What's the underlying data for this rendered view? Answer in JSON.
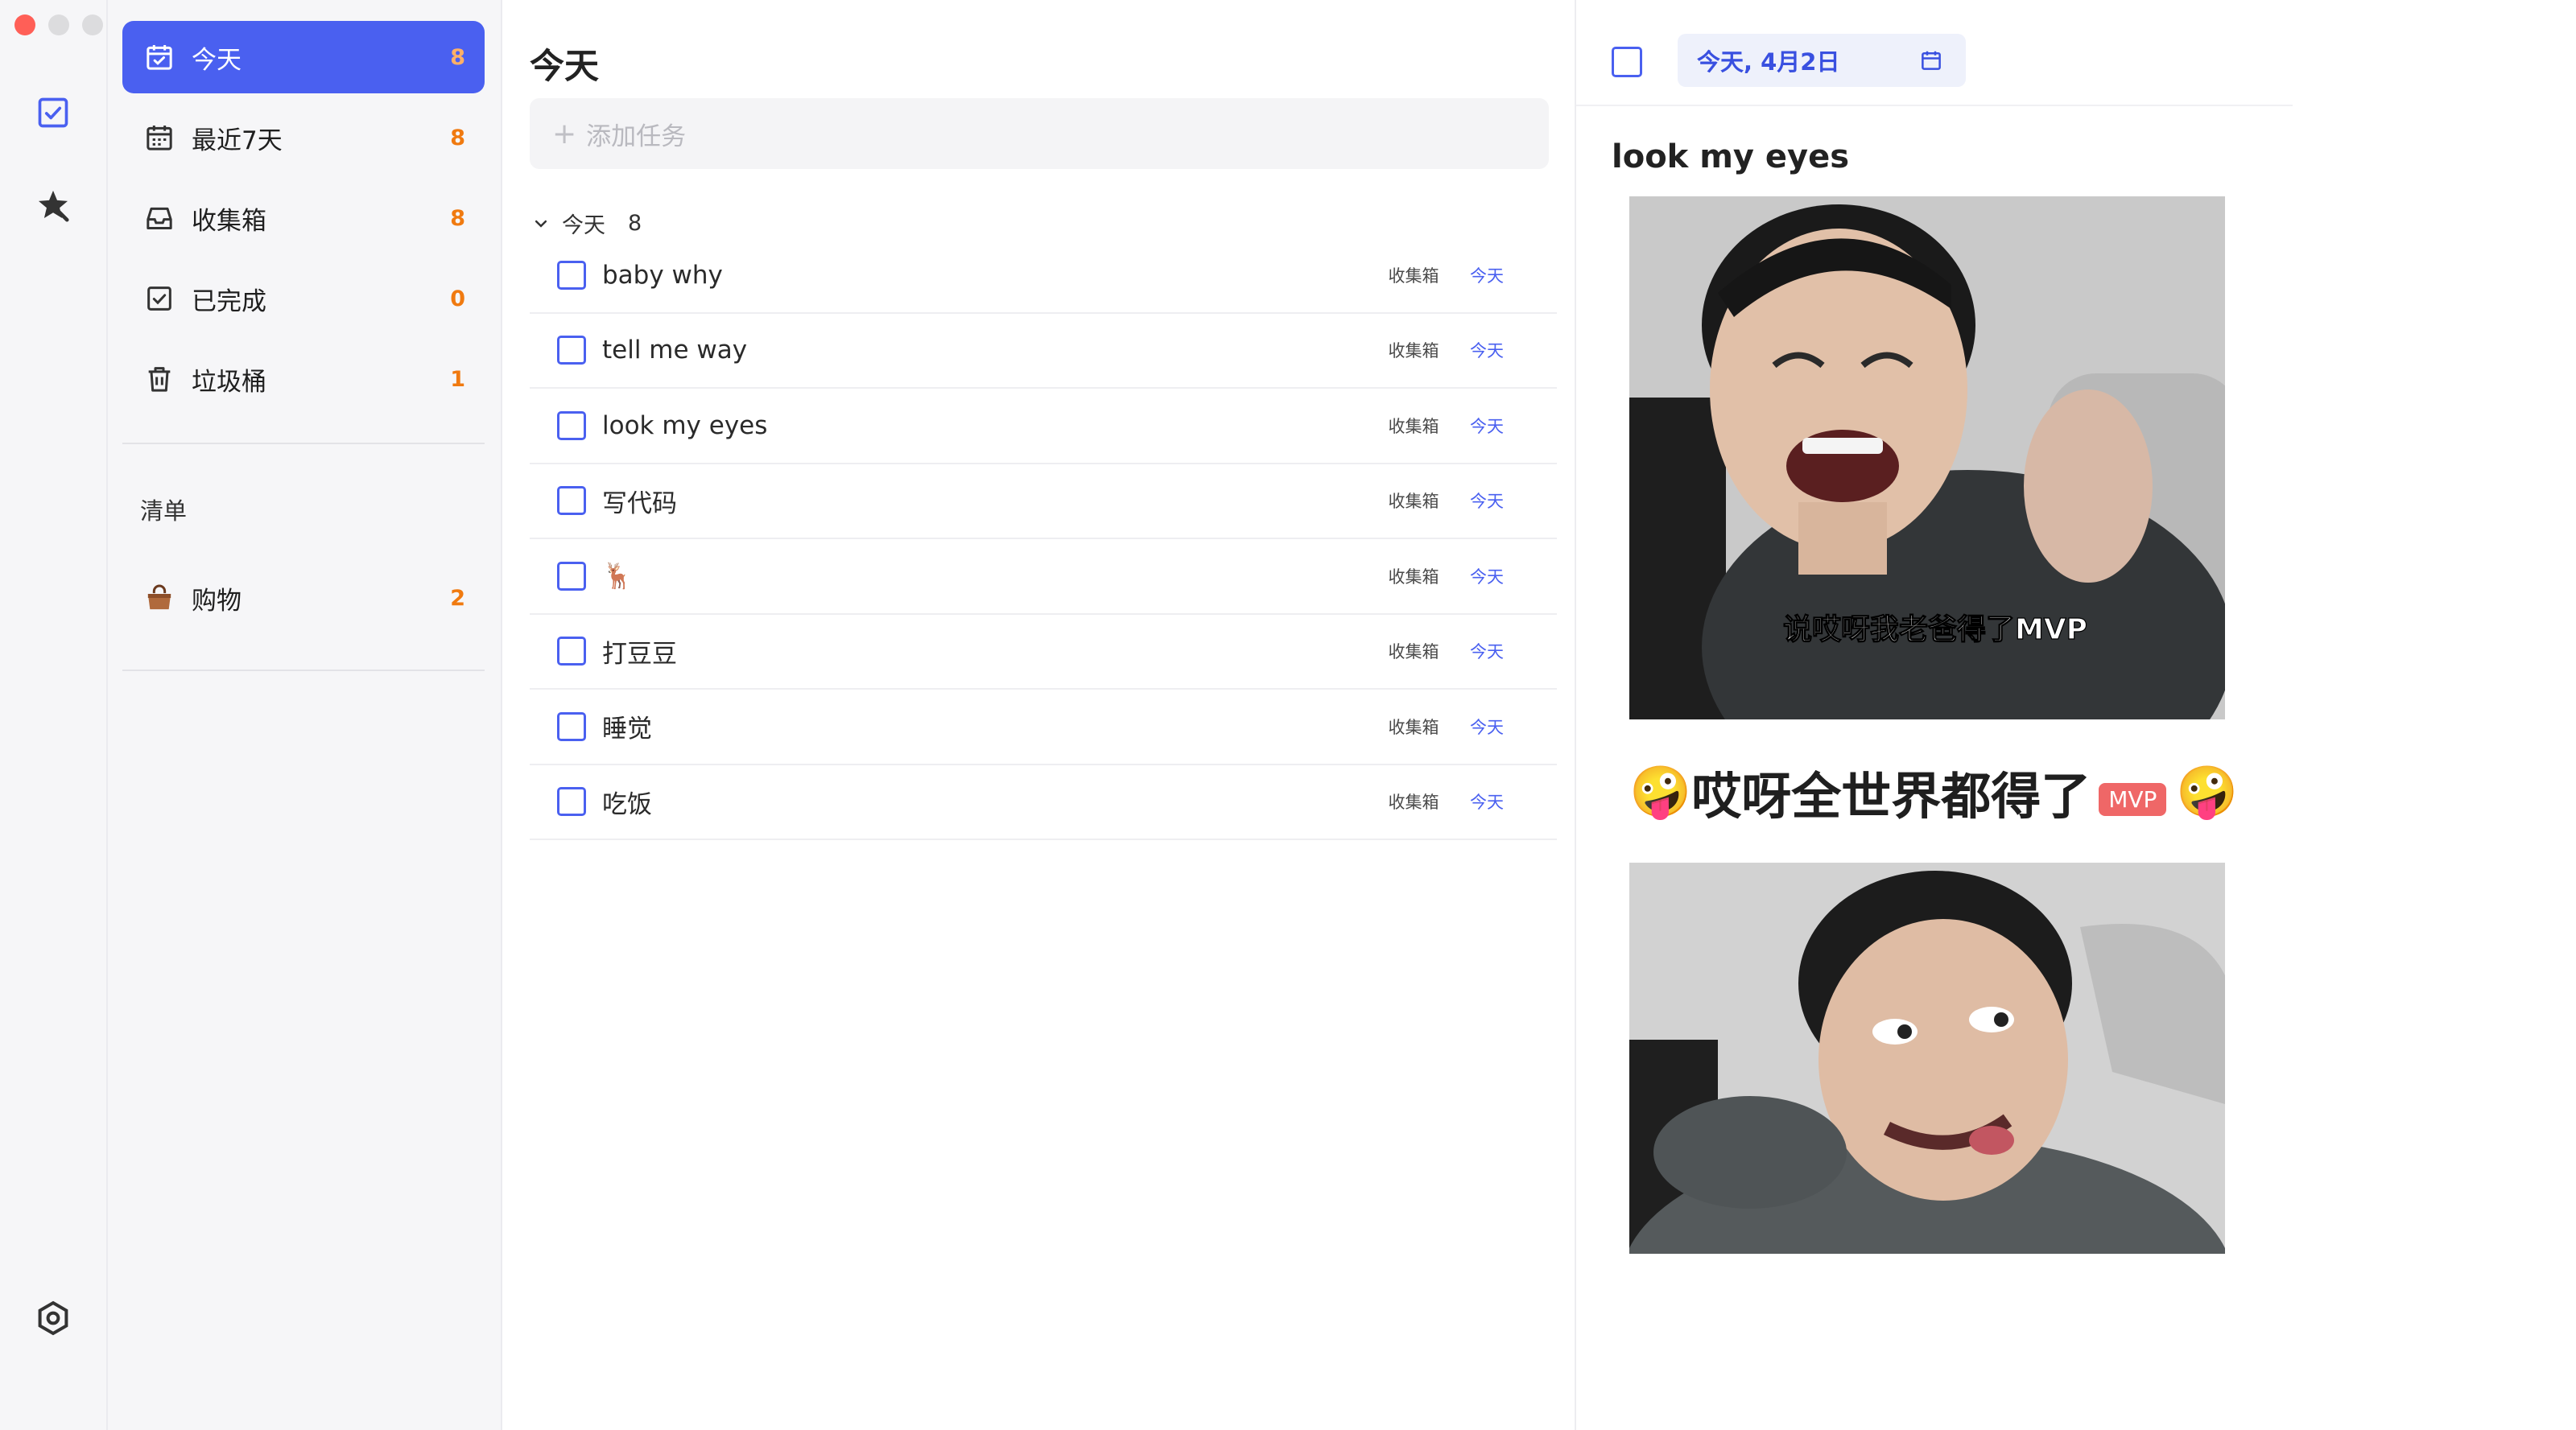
{
  "sidebar": {
    "items": [
      {
        "label": "今天",
        "count": "8"
      },
      {
        "label": "最近7天",
        "count": "8"
      },
      {
        "label": "收集箱",
        "count": "8"
      },
      {
        "label": "已完成",
        "count": "0"
      },
      {
        "label": "垃圾桶",
        "count": "1"
      }
    ],
    "section_title": "清单",
    "lists": [
      {
        "label": "购物",
        "count": "2"
      }
    ]
  },
  "main": {
    "title": "今天",
    "add_placeholder": "添加任务",
    "group": {
      "label": "今天",
      "count": "8"
    },
    "tasks": [
      {
        "title": "baby why",
        "list": "收集箱",
        "due": "今天"
      },
      {
        "title": "tell me way",
        "list": "收集箱",
        "due": "今天"
      },
      {
        "title": "look my eyes",
        "list": "收集箱",
        "due": "今天"
      },
      {
        "title": "写代码",
        "list": "收集箱",
        "due": "今天"
      },
      {
        "title": "🦌",
        "list": "收集箱",
        "due": "今天"
      },
      {
        "title": "打豆豆",
        "list": "收集箱",
        "due": "今天"
      },
      {
        "title": "睡觉",
        "list": "收集箱",
        "due": "今天"
      },
      {
        "title": "吃饭",
        "list": "收集箱",
        "due": "今天"
      }
    ]
  },
  "detail": {
    "date_label": "今天, 4月2日",
    "title": "look my eyes",
    "image1_caption": "说哎呀我老爸得了MVP",
    "emoji_text": "哎呀全世界都得了",
    "badge": "MVP"
  },
  "colors": {
    "accent": "#4a60f0",
    "count_orange": "#f07a10",
    "mvp_badge": "#ef6767"
  }
}
